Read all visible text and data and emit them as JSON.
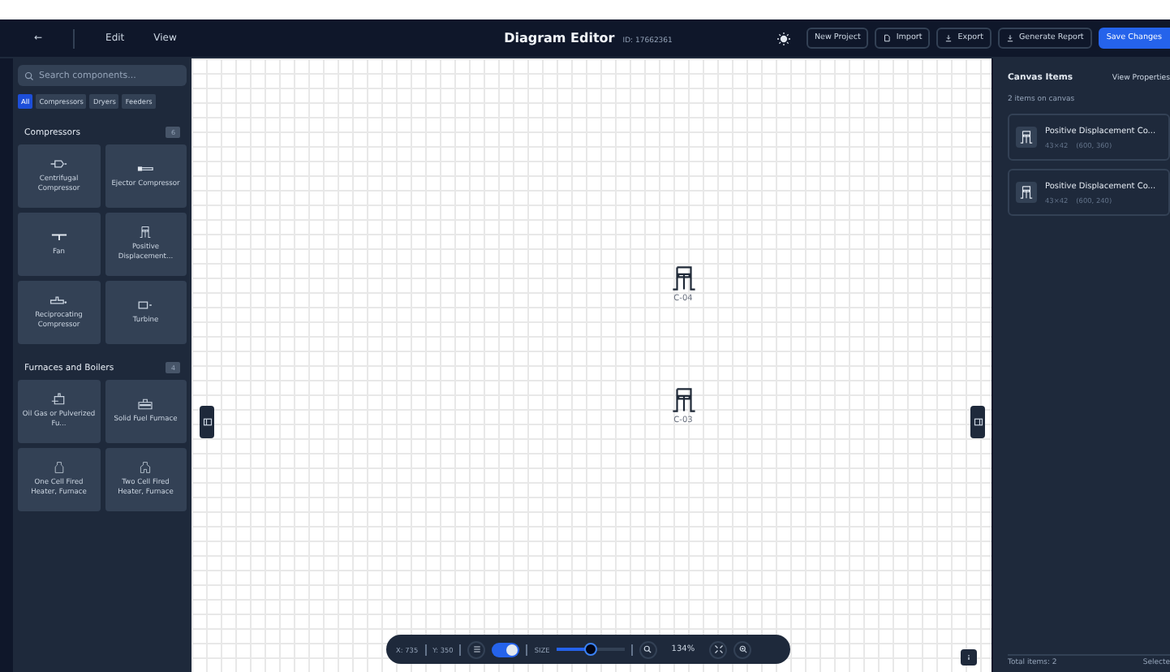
{
  "header": {
    "back": "←",
    "menus": [
      {
        "label": "Edit"
      },
      {
        "label": "View"
      }
    ],
    "title": "Diagram Editor",
    "id_label": "ID: 17662361",
    "buttons": [
      {
        "label": "New Project",
        "kind": "plain"
      },
      {
        "label": "Import",
        "kind": "import"
      },
      {
        "label": "Export",
        "kind": "export"
      },
      {
        "label": "Generate Report",
        "kind": "report"
      },
      {
        "label": "Save Changes",
        "kind": "primary"
      }
    ]
  },
  "sidebar": {
    "search": {
      "placeholder": "Search components..."
    },
    "filters": [
      {
        "label": "All",
        "selected": true
      },
      {
        "label": "Compressors",
        "selected": false
      },
      {
        "label": "Dryers",
        "selected": false
      },
      {
        "label": "Feeders",
        "selected": false
      }
    ],
    "groups": [
      {
        "title": "Compressors",
        "count": "6",
        "items": [
          {
            "label": "Centrifugal Compressor",
            "kind": "centrifugal"
          },
          {
            "label": "Ejector Compressor",
            "kind": "ejector"
          },
          {
            "label": "Fan",
            "kind": "fan"
          },
          {
            "label": "Positive Displacement...",
            "kind": "positive"
          },
          {
            "label": "Reciprocating Compressor",
            "kind": "reciprocating"
          },
          {
            "label": "Turbine",
            "kind": "turbine"
          }
        ]
      },
      {
        "title": "Furnaces and Boilers",
        "count": "4",
        "items": [
          {
            "label": "Oil Gas or Pulverized Fu...",
            "kind": "oilgas"
          },
          {
            "label": "Solid Fuel Furnace",
            "kind": "solid"
          },
          {
            "label": "One Cell Fired Heater, Furnace",
            "kind": "onecell"
          },
          {
            "label": "Two Cell Fired Heater, Furnace",
            "kind": "twocell"
          }
        ]
      }
    ]
  },
  "canvas": {
    "nodes": [
      {
        "label": "C-04",
        "kind": "positive"
      },
      {
        "label": "C-03",
        "kind": "positive"
      }
    ]
  },
  "toolbar": {
    "x": "X: 735",
    "y": "Y: 350",
    "grid_on": true,
    "size_label": "SIZE",
    "level": 0.5,
    "zoom": "134%"
  },
  "panel": {
    "title": "Canvas Items",
    "link": "View Properties",
    "subtitle": "2 items on canvas",
    "items": [
      {
        "name": "Positive Displacement Co...",
        "size": "43×42",
        "position": "(600, 360)"
      },
      {
        "name": "Positive Displacement Co...",
        "size": "43×42",
        "position": "(600, 240)"
      }
    ],
    "footer_left": "Total items: 2",
    "footer_right": "Selecte"
  }
}
